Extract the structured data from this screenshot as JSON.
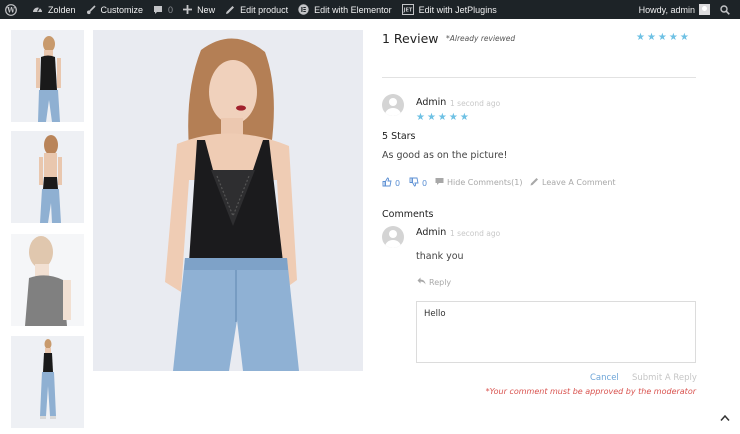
{
  "adminbar": {
    "site_name": "Zolden",
    "customize": "Customize",
    "comments_count": "0",
    "new": "New",
    "edit_product": "Edit product",
    "edit_elementor": "Edit with Elementor",
    "edit_jetplugins": "Edit with JetPlugins",
    "howdy": "Howdy, admin"
  },
  "reviews": {
    "title": "1 Review",
    "already_reviewed": "*Already reviewed",
    "rating_stars": 5
  },
  "review": {
    "author": "Admin",
    "time": "1 second ago",
    "stars": 5,
    "heading": "5 Stars",
    "body": "As good as on the picture!",
    "likes": "0",
    "dislikes": "0",
    "hide_comments": "Hide Comments(1)",
    "leave_comment": "Leave A Comment"
  },
  "comments": {
    "heading": "Comments",
    "items": [
      {
        "author": "Admin",
        "time": "1 second ago",
        "body": "thank you",
        "reply_label": "Reply"
      }
    ]
  },
  "reply_form": {
    "value": "Hello",
    "cancel_label": "Cancel",
    "submit_label": "Submit A Reply",
    "moderation_note": "*Your comment must be approved by the moderator"
  },
  "colors": {
    "admin_bar": "#1d2327",
    "star": "#6ec1e4",
    "warning": "#d9534f",
    "link": "#5b8fd3"
  }
}
